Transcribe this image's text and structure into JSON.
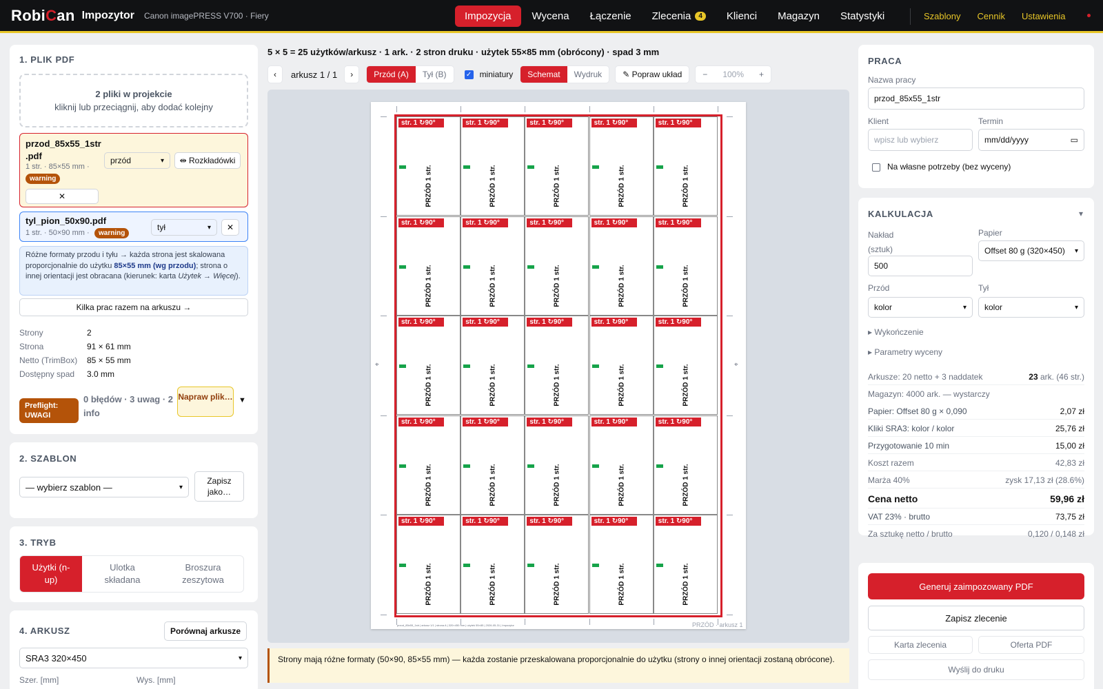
{
  "app": {
    "logo_a": "Robi",
    "logo_c": "C",
    "logo_b": "an",
    "name": "Impozytor",
    "device": "Canon imagePRESS V700 · Fiery"
  },
  "nav": {
    "items": [
      {
        "label": "Impozycja",
        "active": true
      },
      {
        "label": "Wycena"
      },
      {
        "label": "Łączenie"
      },
      {
        "label": "Zlecenia",
        "badge": "4"
      },
      {
        "label": "Klienci"
      },
      {
        "label": "Magazyn"
      },
      {
        "label": "Statystyki"
      }
    ],
    "right": [
      "Szablony",
      "Cennik",
      "Ustawienia"
    ]
  },
  "plik": {
    "title": "1. PLIK PDF",
    "drop_title": "2 pliki w projekcie",
    "drop_hint": "kliknij lub przeciągnij, aby dodać kolejny",
    "file1": {
      "name_a": "przod_85x55_1str",
      "name_b": ".pdf",
      "meta": "1 str. · 85×55 mm ·",
      "badge": "warning",
      "select": "przód",
      "btn": "⇹ Rozkładówki",
      "remove": "✕"
    },
    "file2": {
      "name": "tyl_pion_50x90.pdf",
      "meta": "1 str. · 50×90 mm ·",
      "badge": "warning",
      "select": "tył",
      "remove": "✕"
    },
    "note_a": "Różne formaty przodu i tyłu → każda strona jest skalowana proporcjonalnie do użytku ",
    "note_b": "85×55 mm (wg przodu)",
    "note_c": "; strona o innej orientacji jest obracana (kierunek: karta ",
    "note_d": "Użytek → Więcej",
    "note_e": ").",
    "multi": "Kilka prac razem na arkuszu →",
    "props": [
      {
        "k": "Strony",
        "v": "2"
      },
      {
        "k": "Strona",
        "v": "91 × 61 mm"
      },
      {
        "k": "Netto (TrimBox)",
        "v": "85 × 55 mm"
      },
      {
        "k": "Dostępny spad",
        "v": "3.0 mm"
      }
    ],
    "preflight_badge": "Preflight: UWAGI",
    "preflight_text": "0 błędów · 3 uwag · 2 info",
    "fix_btn": "Napraw plik…",
    "chevron": "▼"
  },
  "szablon": {
    "title": "2. SZABLON",
    "select": "— wybierz szablon —",
    "save": "Zapisz jako…"
  },
  "tryb": {
    "title": "3. TRYB",
    "modes": [
      "Użytki (n-up)",
      "Ulotka składana",
      "Broszura zeszytowa"
    ]
  },
  "arkusz": {
    "title": "4. ARKUSZ",
    "compare": "Porównaj arkusze",
    "select": "SRA3 320×450",
    "w_label": "Szer. [mm]",
    "h_label": "Wys. [mm]"
  },
  "center": {
    "heading": "5 × 5 = 25 użytków/arkusz · 1 ark. · 2 stron druku · użytek 55×85 mm (obrócony) · spad 3 mm",
    "prev": "‹",
    "sheet_label": "arkusz 1 / 1",
    "next": "›",
    "side_front": "Przód (A)",
    "side_back": "Tył (B)",
    "thumbs": "miniatury",
    "view_schema": "Schemat",
    "view_print": "Wydruk",
    "fix_layout": "✎ Popraw układ",
    "zoom_out": "−",
    "zoom": "100%",
    "zoom_in": "+",
    "cell_tag": "str. 1 ↻90°",
    "cell_text": "PRZÓD 1 str.",
    "sheet_footer": "PRZÓD · arkusz 1",
    "sheet_tiny": "przod_85x55_1str | arkusz 1/1 | strona A | 320×450 mm | użytek 55×85 | 2026-05-31 | Impozytor",
    "warning": "Strony mają różne formaty (50×90, 85×55 mm) — każda zostanie przeskalowana proporcjonalnie do użytku (strony o innej orientacji zostaną obrócone)."
  },
  "praca": {
    "title": "PRACA",
    "name_label": "Nazwa pracy",
    "name_value": "przod_85x55_1str",
    "client_label": "Klient",
    "client_placeholder": "wpisz lub wybierz",
    "date_label": "Termin",
    "date_value": "mm/dd/yyyy",
    "own_label": "Na własne potrzeby (bez wyceny)"
  },
  "kalk": {
    "title": "KALKULACJA",
    "chevron": "▾",
    "qty_label_a": "Nakład",
    "qty_label_b": "(sztuk)",
    "qty_value": "500",
    "paper_label": "Papier",
    "paper_value": "Offset 80 g (320×450)",
    "front_label": "Przód",
    "front_value": "kolor",
    "back_label": "Tył",
    "back_value": "kolor",
    "finish": "Wykończenie",
    "params": "Parametry wyceny",
    "sheets_k": "Arkusze: 20 netto + 3 naddatek",
    "sheets_v_b": "23",
    "sheets_v": " ark. (46 str.)",
    "stock": "Magazyn: 4000 ark. — wystarczy",
    "rows": [
      {
        "k": "Papier: Offset 80 g × 0,090",
        "v": "2,07 zł"
      },
      {
        "k": "Kliki SRA3: kolor / kolor",
        "v": "25,76 zł"
      },
      {
        "k": "Przygotowanie 10 min",
        "v": "15,00 zł"
      },
      {
        "k": "Koszt razem",
        "v": "42,83 zł"
      },
      {
        "k": "Marża 40%",
        "v": "zysk 17,13 zł (28.6%)"
      },
      {
        "k": "Cena netto",
        "v": "59,96 zł"
      },
      {
        "k": "VAT 23% · brutto",
        "v": "73,75 zł"
      },
      {
        "k": "Za sztukę netto / brutto",
        "v": "0,120 / 0,148 zł"
      }
    ]
  },
  "actions": {
    "generate": "Generuj zaimpozowany PDF",
    "save_order": "Zapisz zlecenie",
    "card": "Karta zlecenia",
    "offer": "Oferta PDF",
    "send": "Wyślij do druku"
  },
  "colors": {
    "accent": "#d6202b",
    "highlight": "#e8c628",
    "warning": "#b45309",
    "topbar": "#111214"
  },
  "icons": [
    "checkbox-checked-icon",
    "calendar-icon",
    "crosshair-icon",
    "chevron-down-icon",
    "pencil-icon"
  ]
}
